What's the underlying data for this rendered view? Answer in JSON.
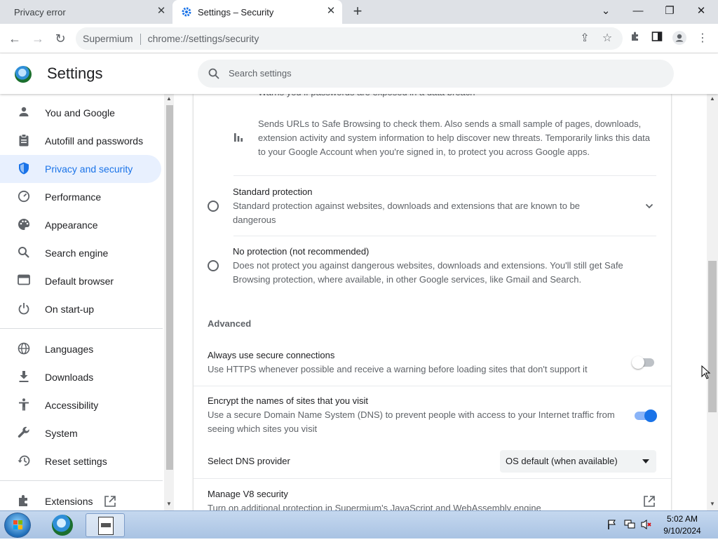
{
  "tabs": [
    {
      "title": "Privacy error"
    },
    {
      "title": "Settings – Security"
    }
  ],
  "toolbar": {
    "site_name": "Supermium",
    "url": "chrome://settings/security"
  },
  "settings": {
    "title": "Settings",
    "search_placeholder": "Search settings"
  },
  "sidebar": {
    "items": [
      {
        "label": "You and Google",
        "icon": "person-icon"
      },
      {
        "label": "Autofill and passwords",
        "icon": "clipboard-icon"
      },
      {
        "label": "Privacy and security",
        "icon": "shield-icon",
        "active": true
      },
      {
        "label": "Performance",
        "icon": "speedometer-icon"
      },
      {
        "label": "Appearance",
        "icon": "palette-icon"
      },
      {
        "label": "Search engine",
        "icon": "search-icon"
      },
      {
        "label": "Default browser",
        "icon": "browser-window-icon"
      },
      {
        "label": "On start-up",
        "icon": "power-icon"
      },
      {
        "label": "Languages",
        "icon": "globe-icon"
      },
      {
        "label": "Downloads",
        "icon": "download-icon"
      },
      {
        "label": "Accessibility",
        "icon": "accessibility-icon"
      },
      {
        "label": "System",
        "icon": "wrench-icon"
      },
      {
        "label": "Reset settings",
        "icon": "history-icon"
      },
      {
        "label": "Extensions",
        "icon": "puzzle-icon"
      }
    ]
  },
  "main": {
    "partial_text": "Warns you if passwords are exposed in a data breach",
    "enhanced_detail": "Sends URLs to Safe Browsing to check them. Also sends a small sample of pages, downloads, extension activity and system information to help discover new threats. Temporarily links this data to your Google Account when you're signed in, to protect you across Google apps.",
    "standard": {
      "title": "Standard protection",
      "desc": "Standard protection against websites, downloads and extensions that are known to be dangerous"
    },
    "none": {
      "title": "No protection (not recommended)",
      "desc": "Does not protect you against dangerous websites, downloads and extensions. You'll still get Safe Browsing protection, where available, in other Google services, like Gmail and Search."
    },
    "advanced_heading": "Advanced",
    "https": {
      "title": "Always use secure connections",
      "desc": "Use HTTPS whenever possible and receive a warning before loading sites that don't support it",
      "enabled": false
    },
    "dns": {
      "title": "Encrypt the names of sites that you visit",
      "desc": "Use a secure Domain Name System (DNS) to prevent people with access to your Internet traffic from seeing which sites you visit",
      "enabled": true
    },
    "dns_provider": {
      "label": "Select DNS provider",
      "value": "OS default (when available)"
    },
    "v8": {
      "title": "Manage V8 security",
      "desc": "Turn on additional protection in Supermium's JavaScript and WebAssembly engine"
    }
  },
  "taskbar": {
    "time": "5:02 AM",
    "date": "9/10/2024"
  },
  "colors": {
    "accent": "#1a73e8",
    "active_nav_bg": "#e8f0fe",
    "taskbar": "#b7cde9"
  }
}
